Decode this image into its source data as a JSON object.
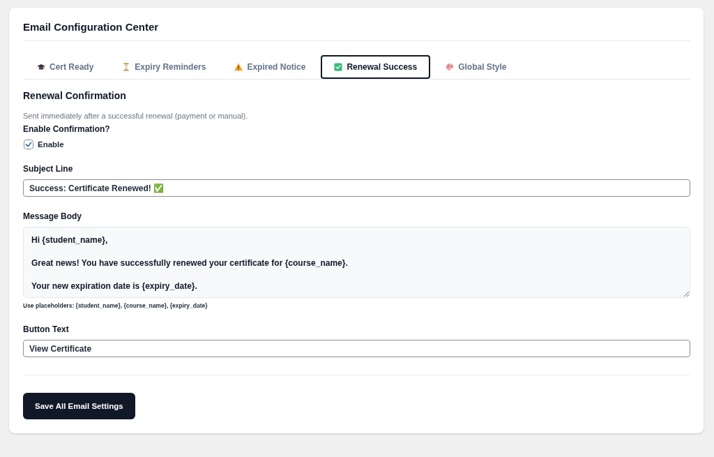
{
  "header": {
    "title": "Email Configuration Center"
  },
  "tabs": [
    {
      "label": "Cert Ready",
      "selected": false
    },
    {
      "label": "Expiry Reminders",
      "selected": false
    },
    {
      "label": "Expired Notice",
      "selected": false
    },
    {
      "label": "Renewal Success",
      "selected": true
    },
    {
      "label": "Global Style",
      "selected": false
    }
  ],
  "section": {
    "title": "Renewal Confirmation",
    "description": "Sent immediately after a successful renewal (payment or manual)."
  },
  "fields": [
    {
      "kind": "checkbox",
      "label": "Enable Confirmation?",
      "option": "Enable",
      "checked": true
    },
    {
      "kind": "text",
      "label": "Subject Line",
      "value": "Success: Certificate Renewed! ✅"
    },
    {
      "kind": "textarea",
      "label": "Message Body",
      "value": "Hi {student_name},\n\nGreat news! You have successfully renewed your certificate for {course_name}.\n\nYour new expiration date is {expiry_date}.",
      "hint": "Use placeholders: {student_name}, {course_name}, {expiry_date}"
    },
    {
      "kind": "text",
      "label": "Button Text",
      "value": "View Certificate"
    }
  ],
  "save_button": {
    "label": "Save All Email Settings"
  }
}
